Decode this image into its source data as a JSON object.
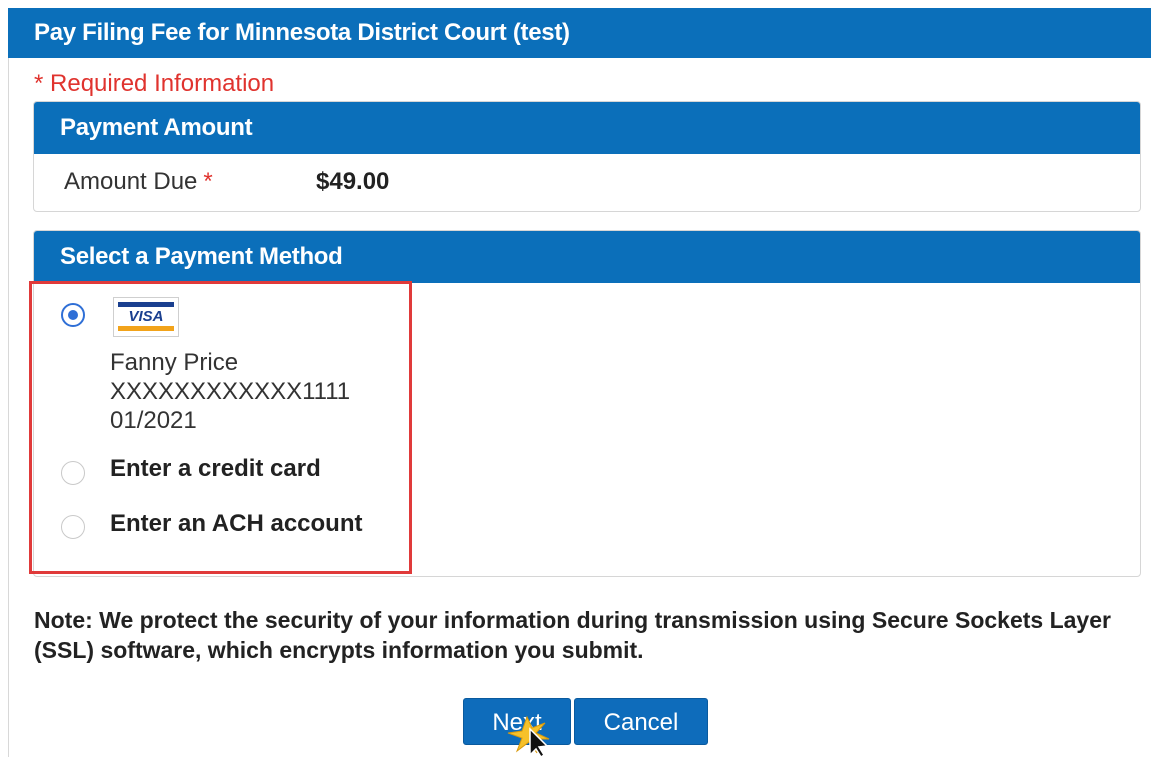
{
  "header": {
    "title": "Pay Filing Fee for Minnesota District Court (test)"
  },
  "required_note": "* Required Information",
  "payment_amount": {
    "title": "Payment Amount",
    "label": "Amount Due",
    "required_mark": "*",
    "value": "$49.00"
  },
  "payment_method": {
    "title": "Select a Payment Method",
    "saved_card": {
      "brand": "VISA",
      "icon": "visa-card-icon",
      "name": "Fanny Price",
      "number": "XXXXXXXXXXXX1111",
      "expiry": "01/2021",
      "selected": true
    },
    "options": [
      {
        "label": "Enter a credit card",
        "selected": false
      },
      {
        "label": "Enter an ACH account",
        "selected": false
      }
    ]
  },
  "note": "Note: We protect the security of your information during transmission using Secure Sockets Layer (SSL) software, which encrypts information you submit.",
  "buttons": {
    "next": "Next",
    "cancel": "Cancel"
  },
  "colors": {
    "header": "#0b6fba",
    "required": "#e0332e",
    "highlight": "#e03a3a",
    "button": "#0e6cbb"
  }
}
